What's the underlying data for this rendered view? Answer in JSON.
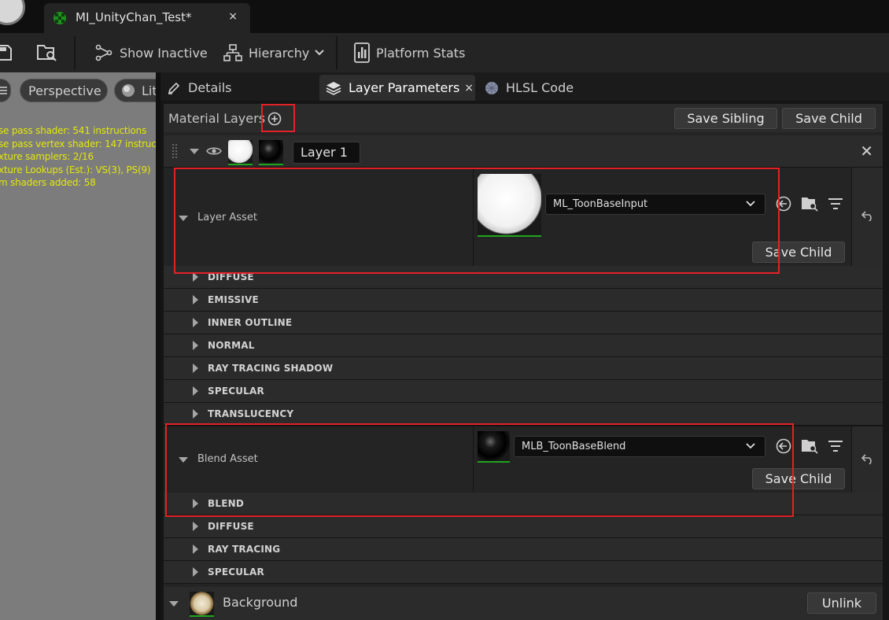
{
  "window": {
    "tab_title": "MI_UnityChan_Test*",
    "tab_close": "×"
  },
  "toolbar": {
    "show_inactive": "Show Inactive",
    "hierarchy": "Hierarchy",
    "platform_stats": "Platform Stats"
  },
  "viewport": {
    "perspective": "Perspective",
    "lit": "Lit",
    "stats": [
      "se pass shader: 541 instructions",
      "se pass vertex shader: 147 instruct",
      "xture samplers: 2/16",
      "xture Lookups (Est.): VS(3), PS(9)",
      "m shaders added: 58"
    ]
  },
  "panel_tabs": {
    "details": "Details",
    "layer_parameters": "Layer Parameters",
    "layer_parameters_close": "×",
    "hlsl_code": "HLSL Code"
  },
  "material_layers": {
    "label": "Material Layers",
    "save_sibling": "Save Sibling",
    "save_child": "Save Child",
    "layer1": {
      "name": "Layer 1",
      "close": "✕",
      "layer_asset": {
        "label": "Layer Asset",
        "value": "ML_ToonBaseInput",
        "save_child": "Save Child"
      },
      "layer_categories": [
        "DIFFUSE",
        "EMISSIVE",
        "INNER OUTLINE",
        "NORMAL",
        "RAY TRACING SHADOW",
        "SPECULAR",
        "TRANSLUCENCY"
      ],
      "blend_asset": {
        "label": "Blend Asset",
        "value": "MLB_ToonBaseBlend",
        "save_child": "Save Child"
      },
      "blend_categories": [
        "BLEND",
        "DIFFUSE",
        "RAY TRACING",
        "SPECULAR"
      ]
    },
    "background": {
      "label": "Background",
      "unlink": "Unlink"
    }
  },
  "colors": {
    "highlight_box": "#e32128",
    "thumbnail_underline": "#1fa520",
    "stats_text": "#e3e80a"
  }
}
